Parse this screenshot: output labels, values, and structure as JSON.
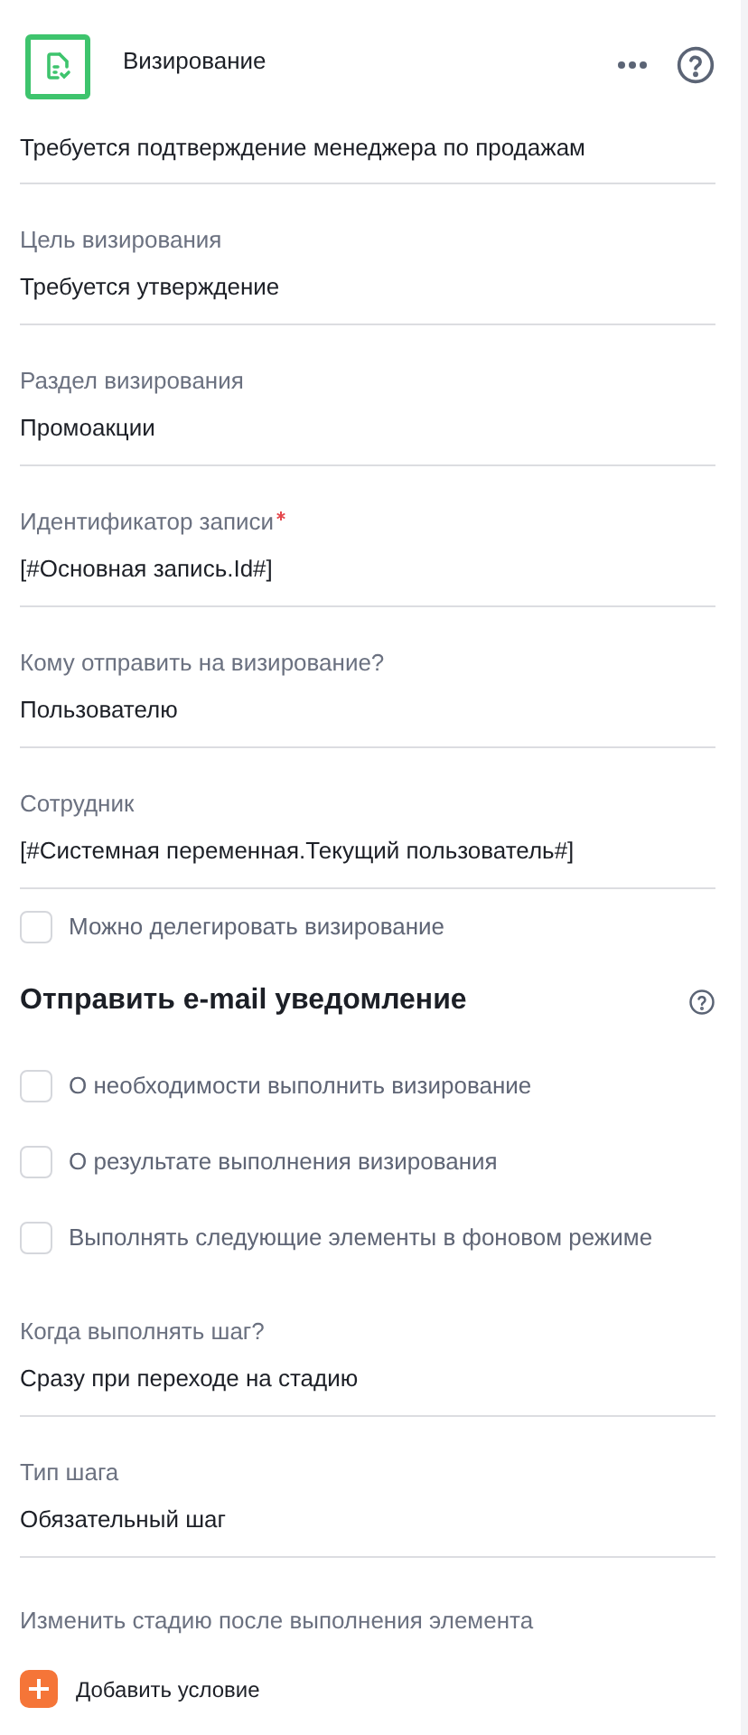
{
  "header": {
    "title": "Визирование"
  },
  "description": "Требуется подтверждение менеджера по продажам",
  "items": [
    {
      "kind": "field",
      "label": "Цель визирования",
      "required": false,
      "value": "Требуется утверждение"
    },
    {
      "kind": "field",
      "label": "Раздел визирования",
      "required": false,
      "value": "Промоакции"
    },
    {
      "kind": "field",
      "label": "Идентификатор записи",
      "required": true,
      "value": "[#Основная запись.Id#]"
    },
    {
      "kind": "field",
      "label": "Кому отправить на визирование?",
      "required": false,
      "value": "Пользователю"
    },
    {
      "kind": "field",
      "label": "Сотрудник",
      "required": false,
      "value": "[#Системная переменная.Текущий пользователь#]"
    },
    {
      "kind": "checkbox",
      "label": "Можно делегировать визирование",
      "checked": false
    },
    {
      "kind": "heading",
      "label": "Отправить e-mail уведомление"
    },
    {
      "kind": "checkbox",
      "label": "О необходимости выполнить визирование",
      "checked": false
    },
    {
      "kind": "checkbox",
      "label": "О результате выполнения визирования",
      "checked": false
    },
    {
      "kind": "checkbox",
      "label": "Выполнять следующие элементы в фоновом режиме",
      "checked": false
    },
    {
      "kind": "field",
      "label": "Когда выполнять шаг?",
      "required": false,
      "value": "Сразу при переходе на стадию"
    },
    {
      "kind": "field",
      "label": "Тип шага",
      "required": false,
      "value": "Обязательный шаг"
    },
    {
      "kind": "label",
      "label": "Изменить стадию после выполнения элемента"
    }
  ],
  "add_button": "Добавить условие"
}
